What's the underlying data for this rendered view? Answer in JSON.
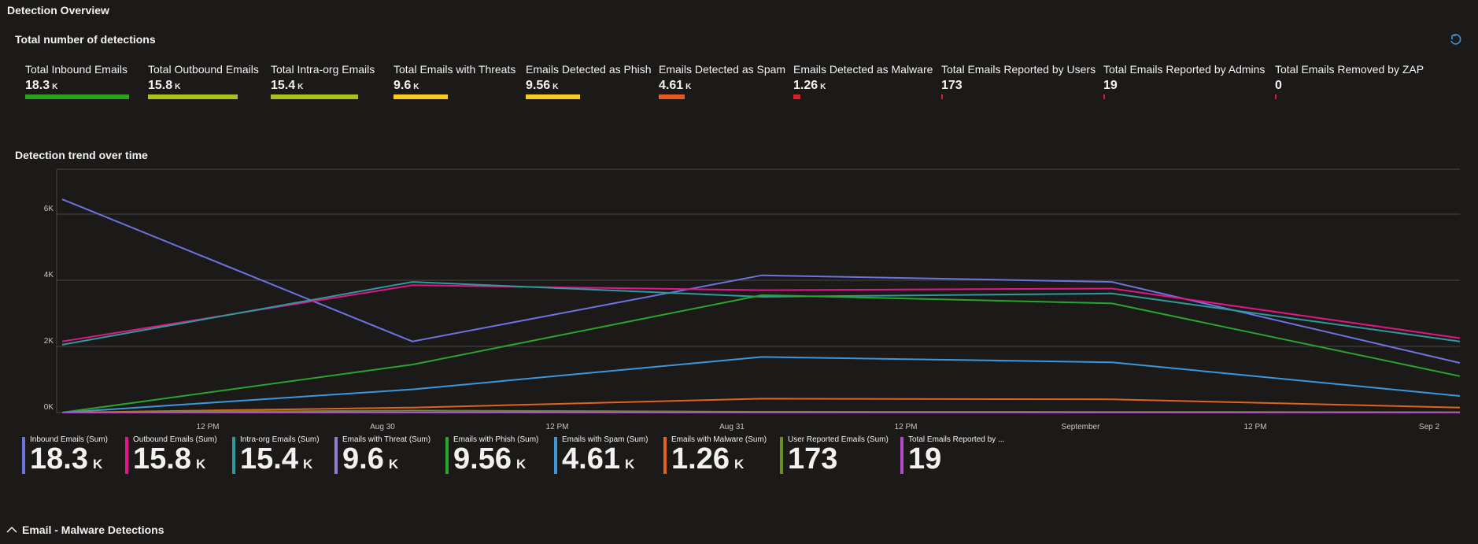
{
  "page": {
    "section_title": "Detection Overview",
    "subtitle": "Total number of detections",
    "trend_title": "Detection trend over time",
    "footer_label": "Email - Malware Detections",
    "refresh_icon": "undo-icon"
  },
  "tiles": [
    {
      "label": "Total Inbound Emails",
      "value": "18.3",
      "unit": "K",
      "color": "#2ea01f",
      "fraction": 1.0
    },
    {
      "label": "Total Outbound Emails",
      "value": "15.8",
      "unit": "K",
      "color": "#a8c01c",
      "fraction": 0.86
    },
    {
      "label": "Total Intra-org Emails",
      "value": "15.4",
      "unit": "K",
      "color": "#a8c01c",
      "fraction": 0.84
    },
    {
      "label": "Total Emails with Threats",
      "value": "9.6",
      "unit": "K",
      "color": "#f8c91e",
      "fraction": 0.52
    },
    {
      "label": "Emails Detected as Phish",
      "value": "9.56",
      "unit": "K",
      "color": "#f8c91e",
      "fraction": 0.52
    },
    {
      "label": "Emails Detected as Spam",
      "value": "4.61",
      "unit": "K",
      "color": "#e55a1e",
      "fraction": 0.25
    },
    {
      "label": "Emails Detected as Malware",
      "value": "1.26",
      "unit": "K",
      "color": "#d4212c",
      "fraction": 0.07
    },
    {
      "label": "Total Emails Reported by Users",
      "value": "173",
      "unit": "",
      "color": "#d4212c",
      "fraction": 0.01
    },
    {
      "label": "Total Emails Reported by Admins",
      "value": "19",
      "unit": "",
      "color": "#d4212c",
      "fraction": 0.005
    },
    {
      "label": "Total Emails Removed by ZAP",
      "value": "0",
      "unit": "",
      "color": "#d4212c",
      "fraction": 0
    }
  ],
  "chart_data": {
    "type": "line",
    "title": "Detection trend over time",
    "xlabel": "",
    "ylabel": "",
    "x_ticks": [
      "12 PM",
      "Aug 30",
      "12 PM",
      "Aug 31",
      "12 PM",
      "September",
      "12 PM",
      "Sep 2"
    ],
    "y_ticks": [
      "0K",
      "2K",
      "4K",
      "6K"
    ],
    "ylim": [
      0,
      7000
    ],
    "grid": true,
    "series": [
      {
        "name": "Inbound Emails (Sum)",
        "color": "#6b73e0",
        "values": [
          6450,
          2150,
          4150,
          3950,
          1500
        ]
      },
      {
        "name": "Outbound Emails (Sum)",
        "color": "#e3158a",
        "values": [
          2150,
          3850,
          3700,
          3750,
          2250
        ]
      },
      {
        "name": "Intra-org Emails (Sum)",
        "color": "#2f9a9a",
        "values": [
          2050,
          3950,
          3500,
          3600,
          2150
        ]
      },
      {
        "name": "Emails with Threat (Sum)",
        "color": "#8f7fd0",
        "values": [
          0,
          0,
          0,
          0,
          0
        ]
      },
      {
        "name": "Emails with Phish (Sum)",
        "color": "#2aa52c",
        "values": [
          0,
          1450,
          3550,
          3300,
          1100
        ]
      },
      {
        "name": "Emails with Spam (Sum)",
        "color": "#3a96dd",
        "values": [
          0,
          700,
          1680,
          1520,
          500
        ]
      },
      {
        "name": "Emails with Malware (Sum)",
        "color": "#e2621e",
        "values": [
          0,
          150,
          420,
          400,
          150
        ]
      },
      {
        "name": "User Reported Emails (Sum)",
        "color": "#6b8e23",
        "values": [
          0,
          60,
          25,
          20,
          10
        ]
      },
      {
        "name": "Total Emails Reported by ...",
        "color": "#b34ac9",
        "values": [
          0,
          5,
          5,
          5,
          2
        ]
      }
    ]
  },
  "legend": [
    {
      "name": "Inbound Emails (Sum)",
      "value": "18.3",
      "unit": "K",
      "color": "#6b73e0"
    },
    {
      "name": "Outbound Emails (Sum)",
      "value": "15.8",
      "unit": "K",
      "color": "#e3158a"
    },
    {
      "name": "Intra-org Emails (Sum)",
      "value": "15.4",
      "unit": "K",
      "color": "#2f9a9a"
    },
    {
      "name": "Emails with Threat (Sum)",
      "value": "9.6",
      "unit": "K",
      "color": "#8f7fd0"
    },
    {
      "name": "Emails with Phish (Sum)",
      "value": "9.56",
      "unit": "K",
      "color": "#2aa52c"
    },
    {
      "name": "Emails with Spam (Sum)",
      "value": "4.61",
      "unit": "K",
      "color": "#3a96dd"
    },
    {
      "name": "Emails with Malware (Sum)",
      "value": "1.26",
      "unit": "K",
      "color": "#e2621e"
    },
    {
      "name": "User Reported Emails (Sum)",
      "value": "173",
      "unit": "",
      "color": "#6b8e23"
    },
    {
      "name": "Total Emails Reported by ...",
      "value": "19",
      "unit": "",
      "color": "#b34ac9"
    }
  ]
}
